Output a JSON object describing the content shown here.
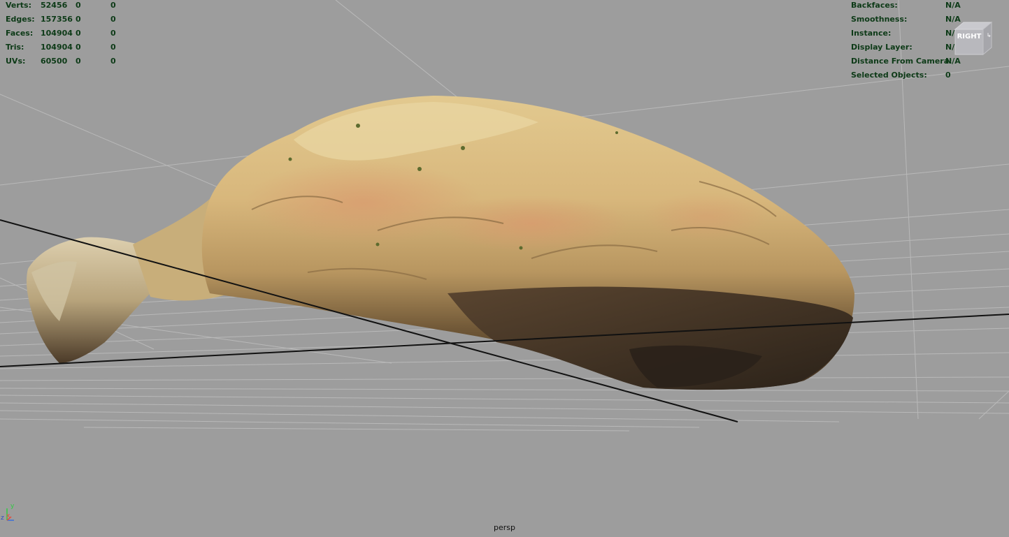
{
  "poly_count": {
    "rows": [
      {
        "label": "Verts:",
        "count": "52456",
        "sel1": "0",
        "sel2": "0"
      },
      {
        "label": "Edges:",
        "count": "157356",
        "sel1": "0",
        "sel2": "0"
      },
      {
        "label": "Faces:",
        "count": "104904",
        "sel1": "0",
        "sel2": "0"
      },
      {
        "label": "Tris:",
        "count": "104904",
        "sel1": "0",
        "sel2": "0"
      },
      {
        "label": "UVs:",
        "count": "60500",
        "sel1": "0",
        "sel2": "0"
      }
    ]
  },
  "object_info": {
    "rows": [
      {
        "label": "Backfaces:",
        "value": "N/A"
      },
      {
        "label": "Smoothness:",
        "value": "N/A"
      },
      {
        "label": "Instance:",
        "value": "N/A"
      },
      {
        "label": "Display Layer:",
        "value": "N/A"
      },
      {
        "label": "Distance From Camera:",
        "value": "N/A"
      },
      {
        "label": "Selected Objects:",
        "value": "0"
      }
    ]
  },
  "view_cube": {
    "face_label": "RIGHT"
  },
  "camera": {
    "name": "persp"
  },
  "axis_gizmo": {
    "x": "x",
    "y": "y",
    "z": "z"
  },
  "colors": {
    "background": "#9d9d9d",
    "hud_text": "#0d3a17",
    "grid_line": "#b9b9b9",
    "axis_line": "#111111"
  }
}
